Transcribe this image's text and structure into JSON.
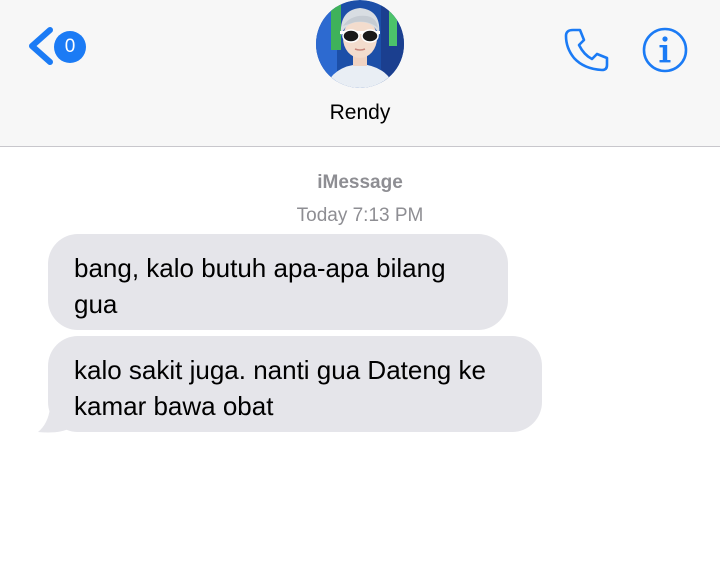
{
  "header": {
    "back_badge_count": "0",
    "contact_name": "Rendy",
    "back_icon": "chevron-left-icon",
    "call_icon": "phone-icon",
    "info_icon": "info-icon"
  },
  "conversation": {
    "service_label": "iMessage",
    "timestamp": "Today 7:13 PM",
    "messages": [
      {
        "direction": "incoming",
        "text_line1": "bang, kalo butuh apa-apa bilang",
        "text_line2": "gua"
      },
      {
        "direction": "incoming",
        "text_line1": "kalo sakit juga. nanti gua Dateng ke",
        "text_line2": "kamar bawa obat"
      }
    ]
  },
  "colors": {
    "accent": "#1b7bf5",
    "incoming_bubble": "#e5e5ea",
    "meta_text": "#8e8e93",
    "header_bg": "#f7f7f7"
  }
}
